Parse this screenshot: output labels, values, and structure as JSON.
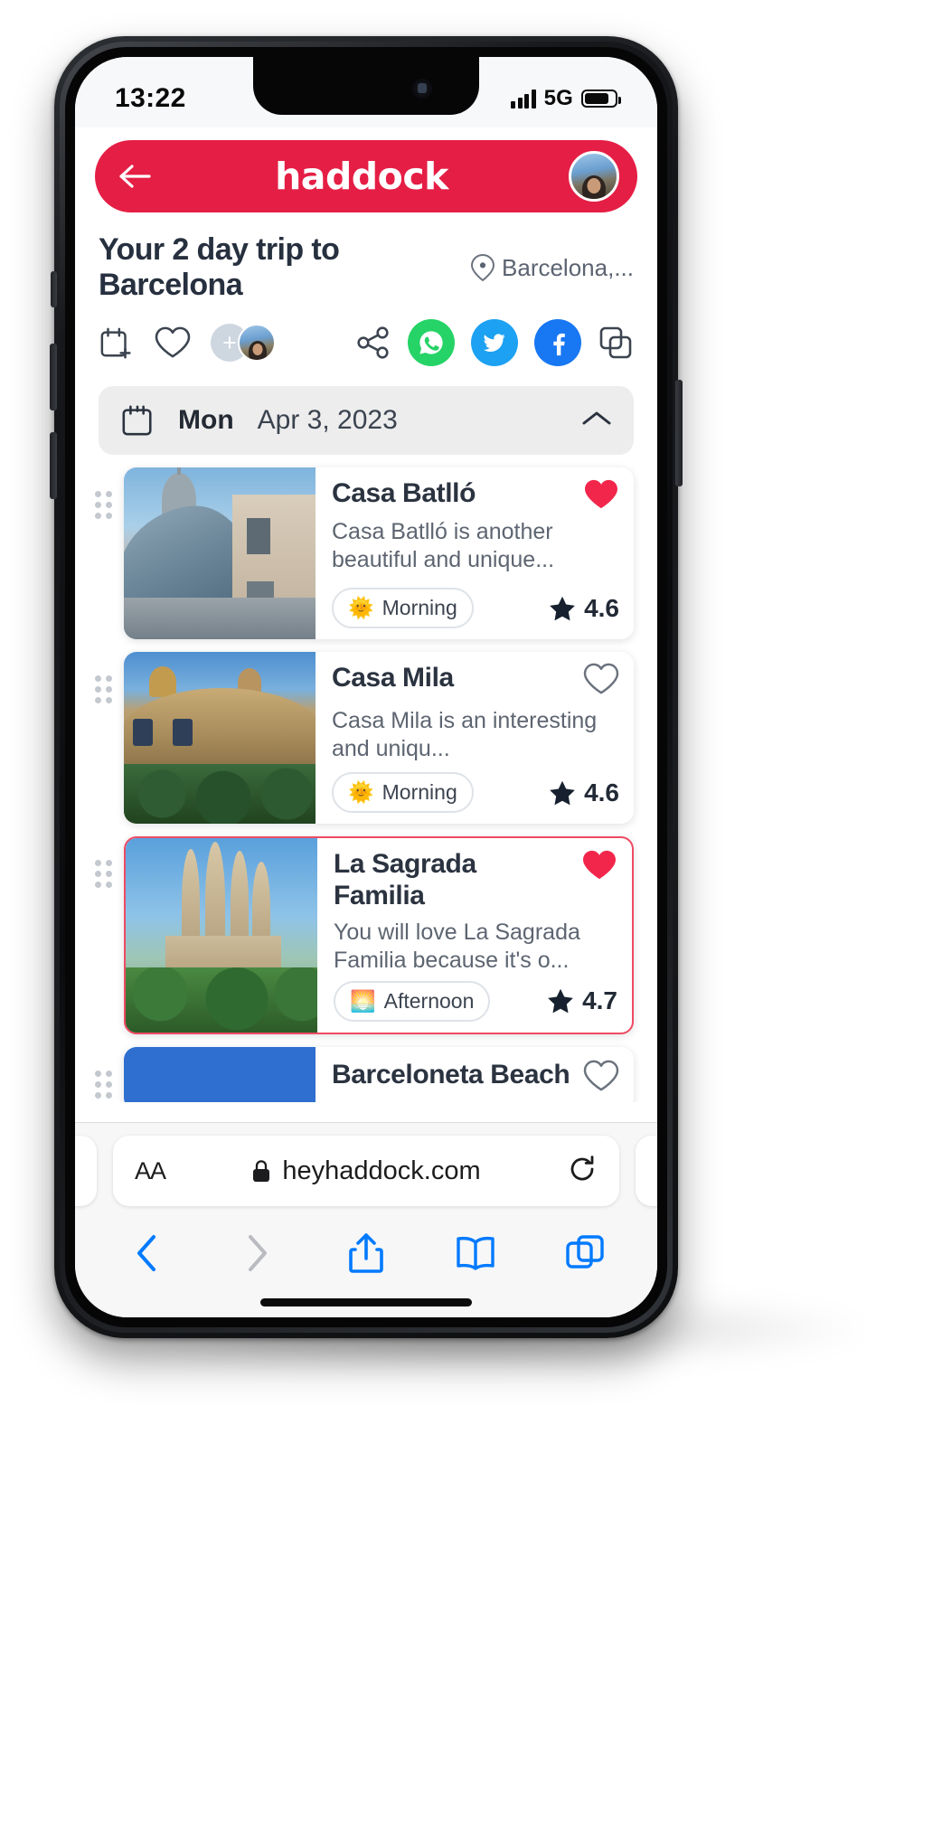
{
  "status_bar": {
    "time": "13:22",
    "network": "5G",
    "battery_level": 82,
    "signal_bars": 4
  },
  "app_header": {
    "logo_text": "haddock",
    "back_icon": "back-arrow-icon",
    "avatar_icon": "user-avatar",
    "brand_color": "#E51E45"
  },
  "trip": {
    "title": "Your 2 day trip to Barcelona",
    "location_label": "Barcelona,...",
    "location_icon": "map-pin-icon"
  },
  "actions": {
    "add_to_calendar_icon": "calendar-add-icon",
    "favorite_icon": "heart-outline-icon",
    "add_person_label": "+",
    "collaborator_avatar": "collaborator-avatar",
    "share_icon": "share-node-icon",
    "whatsapp_icon": "whatsapp-icon",
    "twitter_icon": "twitter-icon",
    "facebook_icon": "facebook-icon",
    "copy_icon": "copy-link-icon",
    "whatsapp_color": "#25D366",
    "twitter_color": "#1DA1F2",
    "facebook_color": "#1877F2"
  },
  "day_header": {
    "calendar_icon": "calendar-icon",
    "day_of_week": "Mon",
    "date": "Apr 3, 2023",
    "collapse_icon": "chevron-up-icon"
  },
  "cards": [
    {
      "name": "Casa Batlló",
      "description": "Casa Batlló is another beautiful and unique...",
      "time_of_day": "Morning",
      "time_icon": "sun-emoji",
      "rating": "4.6",
      "favorited": true,
      "selected": false,
      "drag_handle": "drag-handle-icon"
    },
    {
      "name": "Casa Mila",
      "description": "Casa Mila is an interesting and uniqu...",
      "time_of_day": "Morning",
      "time_icon": "sun-emoji",
      "rating": "4.6",
      "favorited": false,
      "selected": false,
      "drag_handle": "drag-handle-icon"
    },
    {
      "name": "La Sagrada Familia",
      "description": "You will love La Sagrada Familia because it's o...",
      "time_of_day": "Afternoon",
      "time_icon": "sunset-emoji",
      "rating": "4.7",
      "favorited": true,
      "selected": true,
      "drag_handle": "drag-handle-icon"
    },
    {
      "name": "Barceloneta Beach",
      "description": "",
      "time_of_day": "",
      "time_icon": "",
      "rating": "",
      "favorited": false,
      "selected": false,
      "drag_handle": "drag-handle-icon"
    }
  ],
  "browser": {
    "text_size_label": "AA",
    "lock_icon": "lock-icon",
    "url": "heyhaddock.com",
    "reload_icon": "reload-icon",
    "back_icon": "nav-back-icon",
    "forward_icon": "nav-forward-icon",
    "share_icon": "share-up-icon",
    "bookmarks_icon": "book-icon",
    "tabs_icon": "tabs-icon",
    "accent_color": "#007AFF"
  }
}
